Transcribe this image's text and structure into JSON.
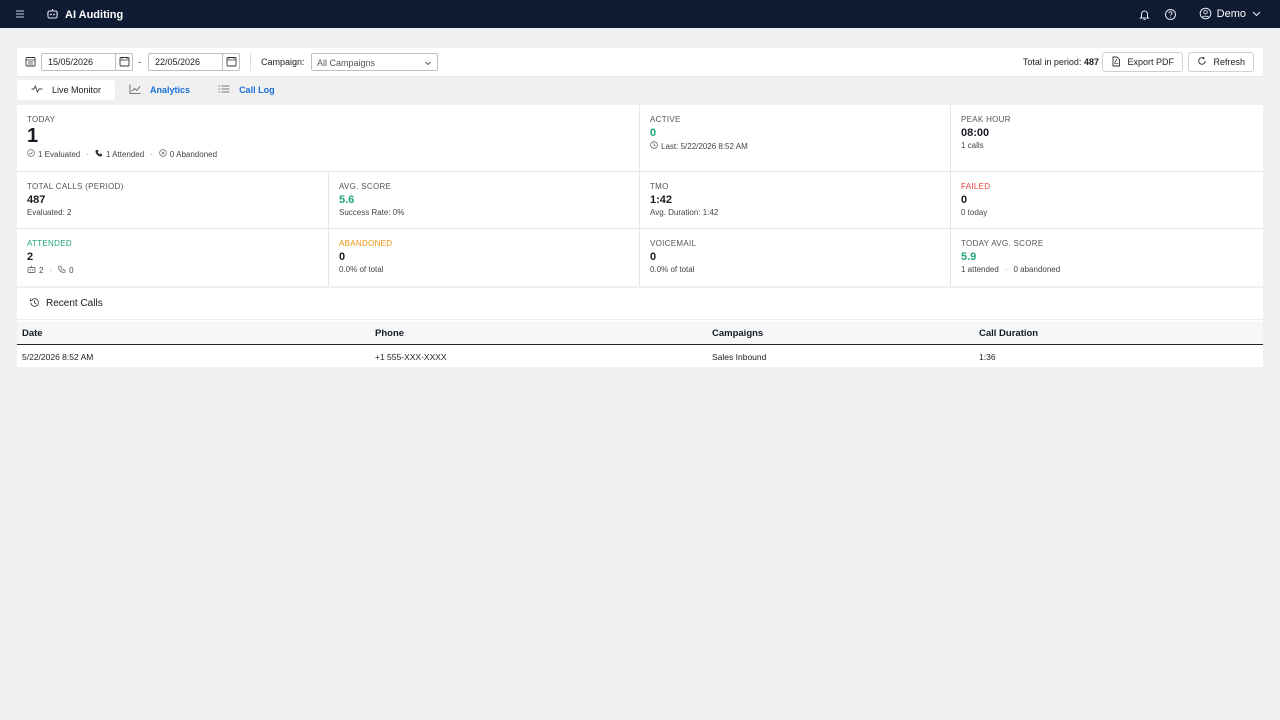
{
  "app": {
    "title": "AI Auditing",
    "user": "Demo"
  },
  "filters": {
    "date_from": "15/05/2026",
    "date_to": "22/05/2026",
    "separator": "-",
    "campaign_label": "Campaign:",
    "campaign_value": "All Campaigns",
    "total_label": "Total in period:",
    "total_value": "487",
    "export_label": "Export PDF",
    "refresh_label": "Refresh"
  },
  "tabs": [
    {
      "label": "Live Monitor",
      "icon": "activity-icon",
      "active": true
    },
    {
      "label": "Analytics",
      "icon": "line-chart-icon",
      "active": false
    },
    {
      "label": "Call Log",
      "icon": "list-icon",
      "active": false
    }
  ],
  "stats": {
    "today": {
      "label": "TODAY",
      "value": "1",
      "evaluated": "1 Evaluated",
      "attended": "1 Attended",
      "abandoned": "0 Abandoned"
    },
    "active": {
      "label": "ACTIVE",
      "value": "0",
      "last": "Last: 5/22/2026 8:52 AM"
    },
    "peak_hour": {
      "label": "PEAK HOUR",
      "value": "08:00",
      "sub": "1 calls"
    },
    "total_calls": {
      "label": "TOTAL CALLS (PERIOD)",
      "value": "487",
      "sub": "Evaluated: 2"
    },
    "avg_score": {
      "label": "AVG. SCORE",
      "value": "5.6",
      "sub": "Success Rate: 0%"
    },
    "tmo": {
      "label": "TMO",
      "value": "1:42",
      "sub": "Avg. Duration: 1:42"
    },
    "failed": {
      "label": "FAILED",
      "value": "0",
      "sub": "0 today"
    },
    "attended": {
      "label": "ATTENDED",
      "value": "2",
      "bot_count": "2",
      "phone_count": "0"
    },
    "abandoned": {
      "label": "ABANDONED",
      "value": "0",
      "sub": "0.0% of total"
    },
    "voicemail": {
      "label": "VOICEMAIL",
      "value": "0",
      "sub": "0.0% of total"
    },
    "today_avg_score": {
      "label": "TODAY AVG. SCORE",
      "value": "5.9",
      "attended": "1 attended",
      "abandoned": "0 abandoned"
    }
  },
  "recent_calls": {
    "title": "Recent Calls",
    "columns": [
      "Date",
      "Phone",
      "Campaigns",
      "Call Duration"
    ],
    "rows": [
      [
        "5/22/2026 8:52 AM",
        "+1 555-XXX-XXXX",
        "Sales Inbound",
        "1:36"
      ]
    ]
  },
  "colors": {
    "topbar": "#0f1a33",
    "green": "#1fa672",
    "red": "#e0403a",
    "orange": "#e8910c",
    "link": "#1a6fd6"
  }
}
